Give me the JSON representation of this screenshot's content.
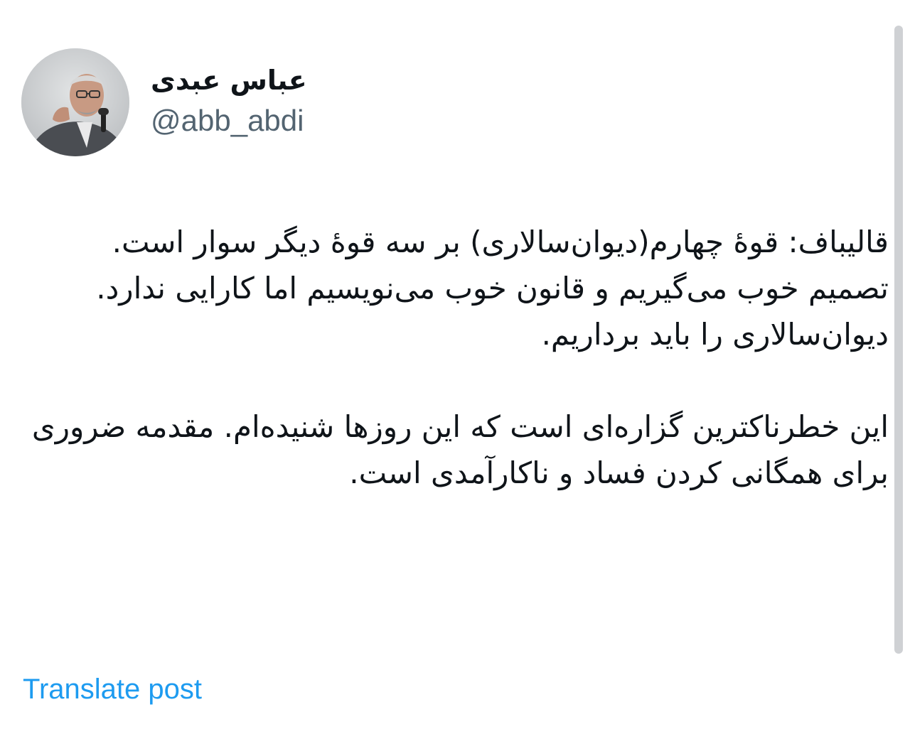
{
  "post": {
    "author": {
      "display_name": "عباس عبدی",
      "handle": "@abb_abdi"
    },
    "paragraphs": [
      "قالیباف: قوهٔ چهارم(دیوان‌سالاری) بر سه قوهٔ دیگر سوار است. تصمیم خوب می‌گیریم و قانون خوب می‌نویسیم اما کارایی ندارد. دیوان‌سالاری را باید برداریم.",
      "این خطرناکترین گزاره‌ای است که این روزها شنیده‌ام. مقدمه ضروری برای همگانی کردن فساد و ناکارآمدی است."
    ],
    "translate_label": "Translate post"
  },
  "colors": {
    "text": "#0f1419",
    "handle": "#536471",
    "link": "#1d9bf0"
  }
}
